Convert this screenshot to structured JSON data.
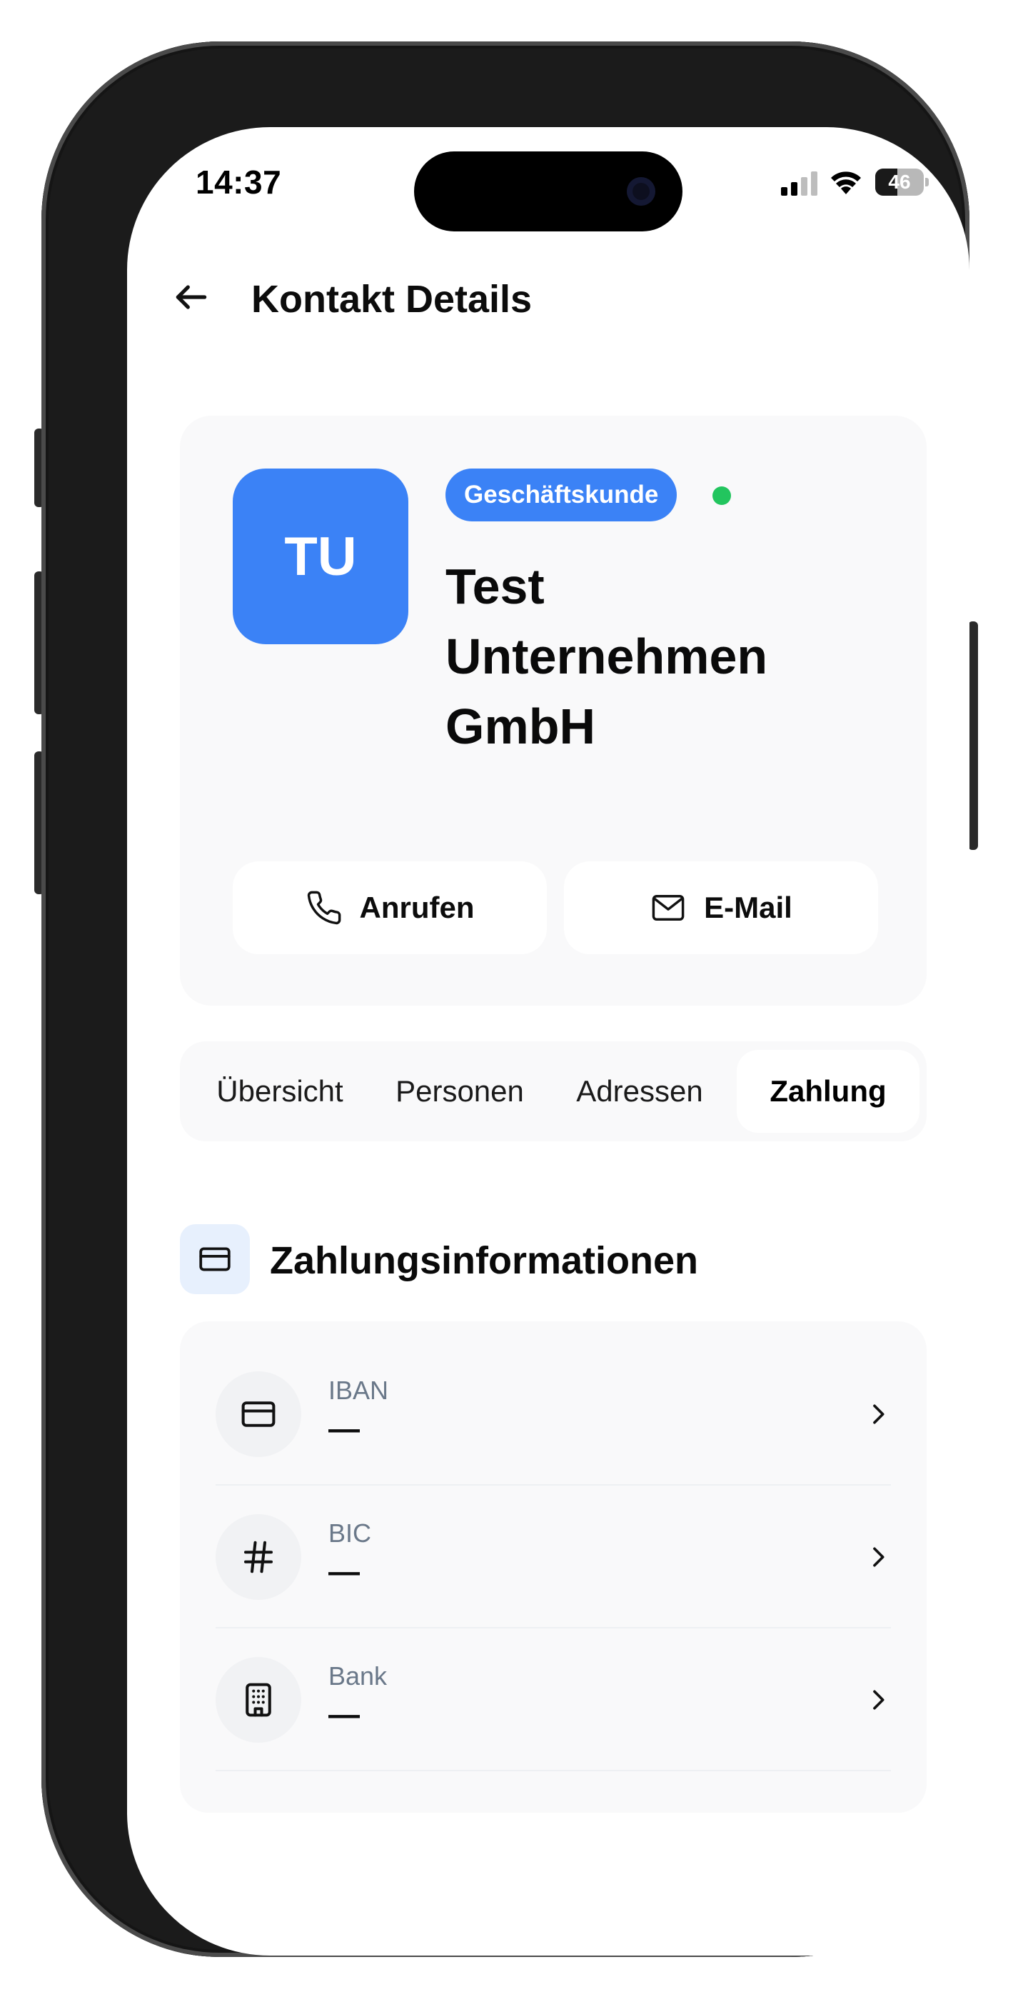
{
  "status_bar": {
    "time": "14:37",
    "battery_level": "46",
    "battery_fraction": 0.46
  },
  "header": {
    "back_icon": "arrow-left-icon",
    "title": "Kontakt Details"
  },
  "profile": {
    "initials": "TU",
    "badge": "Geschäftskunde",
    "status_color": "#22c55e",
    "name": "Test Unternehmen GmbH",
    "accent_color": "#3b82f6",
    "actions": [
      {
        "label": "Anrufen",
        "icon": "phone-icon"
      },
      {
        "label": "E-Mail",
        "icon": "mail-icon"
      }
    ]
  },
  "tabs": [
    {
      "label": "Übersicht",
      "active": false
    },
    {
      "label": "Personen",
      "active": false
    },
    {
      "label": "Adressen",
      "active": false
    },
    {
      "label": "Zahlung",
      "active": true
    }
  ],
  "section": {
    "title": "Zahlungsinformationen",
    "icon": "credit-card-icon",
    "rows": [
      {
        "label": "IBAN",
        "value": "—",
        "icon": "credit-card-icon"
      },
      {
        "label": "BIC",
        "value": "—",
        "icon": "hash-icon"
      },
      {
        "label": "Bank",
        "value": "—",
        "icon": "building-icon"
      }
    ]
  }
}
